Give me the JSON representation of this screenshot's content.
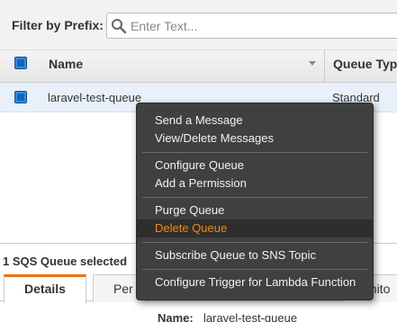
{
  "filter": {
    "label": "Filter by Prefix:",
    "placeholder": "Enter Text...",
    "value": ""
  },
  "table": {
    "columns": [
      "Name",
      "Queue Typ"
    ],
    "rows": [
      {
        "name": "laravel-test-queue",
        "type": "Standard",
        "selected": true
      }
    ]
  },
  "context_menu": {
    "groups": [
      [
        "Send a Message",
        "View/Delete Messages"
      ],
      [
        "Configure Queue",
        "Add a Permission"
      ],
      [
        "Purge Queue",
        "Delete Queue"
      ],
      [
        "Subscribe Queue to SNS Topic"
      ],
      [
        "Configure Trigger for Lambda Function"
      ]
    ],
    "highlighted": "Delete Queue"
  },
  "details_panel": {
    "selected_count": "1 SQS Queue selected",
    "tabs": [
      "Details",
      "Per",
      "onito"
    ],
    "active_tab": "Details",
    "name_label": "Name:",
    "name_value": "laravel-test-queue"
  },
  "colors": {
    "accent": "#ec7211",
    "checkbox": "#1166bb",
    "menu_bg": "#404040",
    "danger_text": "#f38a16"
  },
  "icons": {
    "search": "search-icon",
    "sort": "sort-caret-icon"
  }
}
